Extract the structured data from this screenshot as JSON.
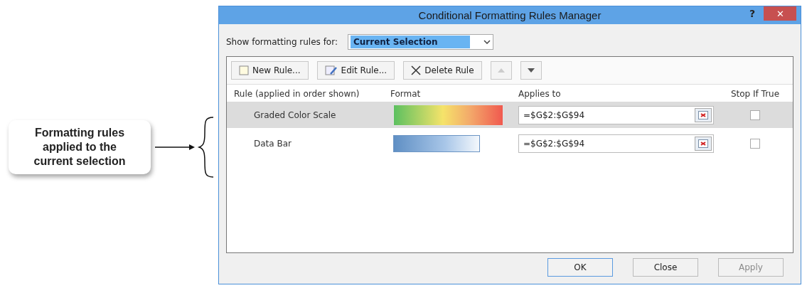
{
  "callout": {
    "text": "Formatting rules applied to the current selection"
  },
  "window": {
    "title": "Conditional Formatting Rules Manager",
    "help": "?",
    "close": "✕"
  },
  "show_rules_for": {
    "label": "Show formatting rules for:",
    "value": "Current Selection"
  },
  "toolbar": [
    {
      "kind": "new",
      "label": "New Rule...",
      "disabled": false
    },
    {
      "kind": "edit",
      "label": "Edit Rule...",
      "disabled": false
    },
    {
      "kind": "delete",
      "label": "Delete Rule",
      "disabled": false
    },
    {
      "kind": "up",
      "disabled": true
    },
    {
      "kind": "down",
      "disabled": false
    }
  ],
  "columns": [
    "Rule (applied in order shown)",
    "Format",
    "Applies to",
    "Stop If True"
  ],
  "rules": [
    {
      "name": "Graded Color Scale",
      "kind": "color_scale",
      "applies_to": "=$G$2:$G$94",
      "stop_if_true": false,
      "selected": true
    },
    {
      "name": "Data Bar",
      "kind": "data_bar",
      "applies_to": "=$G$2:$G$94",
      "stop_if_true": false,
      "selected": false
    }
  ],
  "buttons": [
    {
      "label": "OK",
      "disabled": false,
      "selected": true
    },
    {
      "label": "Close",
      "disabled": false,
      "selected": false
    },
    {
      "label": "Apply",
      "disabled": true,
      "selected": false
    }
  ]
}
